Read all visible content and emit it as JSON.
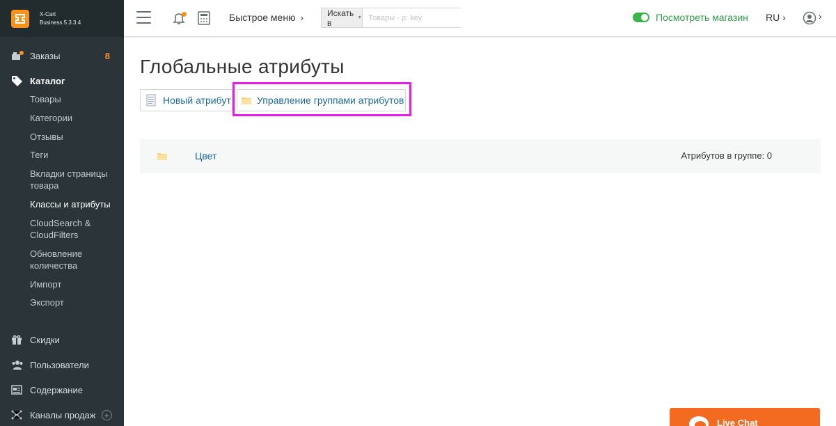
{
  "brand": {
    "name": "X-Cart",
    "edition": "Business 5.3.3.4"
  },
  "sidebar": {
    "orders": {
      "label": "Заказы",
      "count": "8"
    },
    "catalog": {
      "label": "Каталог",
      "items": [
        "Товары",
        "Категории",
        "Отзывы",
        "Теги",
        "Вкладки страницы товара",
        "Классы и атрибуты",
        "CloudSearch & CloudFilters",
        "Обновление количества",
        "Импорт",
        "Экспорт"
      ]
    },
    "discounts": "Скидки",
    "users": "Пользователи",
    "content": "Содержание",
    "sales_channels": "Каналы продаж"
  },
  "header": {
    "quick_menu": "Быстрое меню",
    "search_in": "Искать в",
    "search_placeholder": "Товары - p: key",
    "view_store": "Посмотреть магазин",
    "language": "RU"
  },
  "main": {
    "title": "Глобальные атрибуты",
    "new_attribute": "Новый атрибут",
    "manage_groups": "Управление группами атрибутов",
    "group": {
      "name": "Цвет",
      "count_text": "Атрибутов в группе: 0"
    }
  },
  "live_chat": "Live Chat",
  "colors": {
    "accent": "#f7931d",
    "link": "#1b6a9e",
    "store_green": "#2f9b4b",
    "highlight": "#e91ce8",
    "chat": "#f26b21"
  }
}
